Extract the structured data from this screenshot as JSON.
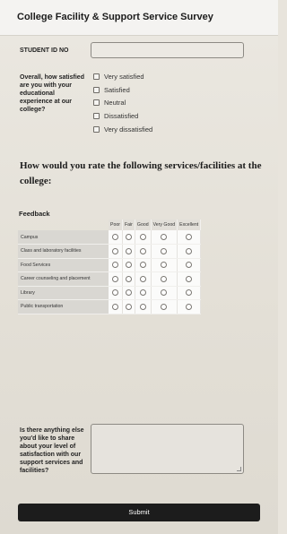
{
  "header": {
    "title": "College Facility & Support Service Survey"
  },
  "student_id": {
    "label": "STUDENT ID NO",
    "value": ""
  },
  "satisfaction": {
    "question": "Overall, how satisfied are you with your educational experience at our college?",
    "options": [
      "Very satisfied",
      "Satisfied",
      "Neutral",
      "Dissatisfied",
      "Very dissatisfied"
    ]
  },
  "services_heading": "How would you rate the following services/facilities at the college:",
  "feedback": {
    "title": "Feedback",
    "columns": [
      "Poor",
      "Fair",
      "Good",
      "Very Good",
      "Excellent"
    ],
    "rows": [
      "Campus",
      "Class and laboratory facilities",
      "Food Services",
      "Career counseling and placement",
      "Library",
      "Public transportation"
    ]
  },
  "comments": {
    "question": "Is there anything else you'd like to share about your level of satisfaction with our support services and facilities?",
    "value": ""
  },
  "submit_label": "Submit"
}
